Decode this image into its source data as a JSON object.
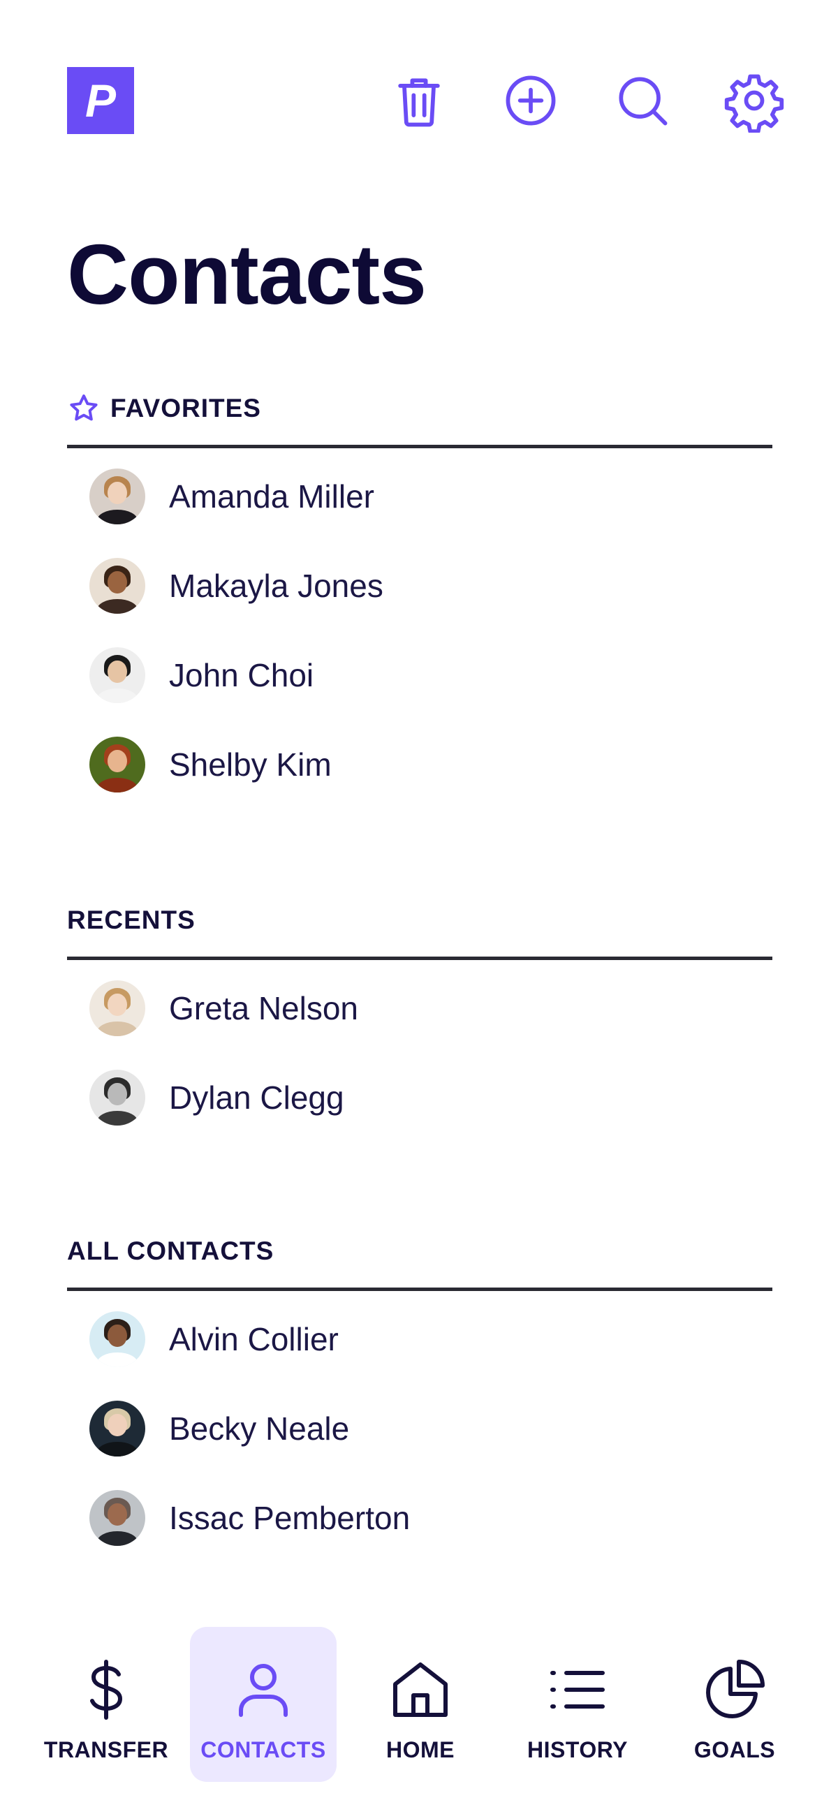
{
  "app": {
    "logo_letter": "P",
    "accent_color": "#6a4cf5",
    "active_tab_bg": "#ece8ff"
  },
  "toolbar": {
    "icons": [
      "trash-icon",
      "plus-circle-icon",
      "search-icon",
      "gear-icon"
    ]
  },
  "page": {
    "title": "Contacts"
  },
  "favorites": {
    "title": "FAVORITES",
    "icon": "star-icon",
    "contacts": [
      {
        "name": "Amanda Miller"
      },
      {
        "name": "Makayla Jones"
      },
      {
        "name": "John Choi"
      },
      {
        "name": "Shelby Kim"
      }
    ]
  },
  "recents": {
    "title": "RECENTS",
    "contacts": [
      {
        "name": "Greta Nelson"
      },
      {
        "name": "Dylan Clegg"
      }
    ]
  },
  "all_contacts": {
    "title": "ALL CONTACTS",
    "contacts": [
      {
        "name": "Alvin Collier"
      },
      {
        "name": "Becky Neale"
      },
      {
        "name": "Issac Pemberton"
      }
    ]
  },
  "bottom_nav": {
    "items": [
      {
        "label": "TRANSFER",
        "icon": "dollar-icon",
        "active": false
      },
      {
        "label": "CONTACTS",
        "icon": "person-icon",
        "active": true
      },
      {
        "label": "HOME",
        "icon": "home-icon",
        "active": false
      },
      {
        "label": "HISTORY",
        "icon": "list-icon",
        "active": false
      },
      {
        "label": "GOALS",
        "icon": "pie-chart-icon",
        "active": false
      }
    ]
  }
}
